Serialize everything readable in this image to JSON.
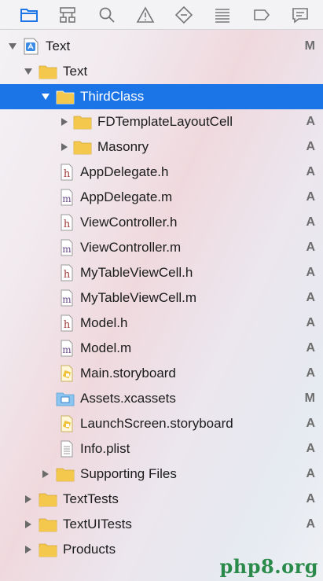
{
  "toolbar": {
    "icons": [
      "folder-icon",
      "hierarchy-icon",
      "search-icon",
      "warning-icon",
      "breakpoint-icon",
      "list-icon",
      "tag-icon",
      "comment-icon"
    ]
  },
  "colors": {
    "accent": "#1c75e6",
    "folder": "#f4c84d",
    "badge": "#6d6d6d"
  },
  "tree": [
    {
      "name": "Text",
      "type": "project",
      "disclosure": "open",
      "badge": "M"
    },
    {
      "name": "Text",
      "type": "folder",
      "disclosure": "open",
      "badge": ""
    },
    {
      "name": "ThirdClass",
      "type": "folder",
      "disclosure": "open",
      "badge": "",
      "selected": true
    },
    {
      "name": "FDTemplateLayoutCell",
      "type": "folder",
      "disclosure": "closed",
      "badge": "A"
    },
    {
      "name": "Masonry",
      "type": "folder",
      "disclosure": "closed",
      "badge": "A"
    },
    {
      "name": "AppDelegate.h",
      "type": "h",
      "disclosure": "none",
      "badge": "A"
    },
    {
      "name": "AppDelegate.m",
      "type": "m",
      "disclosure": "none",
      "badge": "A"
    },
    {
      "name": "ViewController.h",
      "type": "h",
      "disclosure": "none",
      "badge": "A"
    },
    {
      "name": "ViewController.m",
      "type": "m",
      "disclosure": "none",
      "badge": "A"
    },
    {
      "name": "MyTableViewCell.h",
      "type": "h",
      "disclosure": "none",
      "badge": "A"
    },
    {
      "name": "MyTableViewCell.m",
      "type": "m",
      "disclosure": "none",
      "badge": "A"
    },
    {
      "name": "Model.h",
      "type": "h",
      "disclosure": "none",
      "badge": "A"
    },
    {
      "name": "Model.m",
      "type": "m",
      "disclosure": "none",
      "badge": "A"
    },
    {
      "name": "Main.storyboard",
      "type": "storyboard",
      "disclosure": "none",
      "badge": "A"
    },
    {
      "name": "Assets.xcassets",
      "type": "xcassets",
      "disclosure": "none",
      "badge": "M"
    },
    {
      "name": "LaunchScreen.storyboard",
      "type": "storyboard",
      "disclosure": "none",
      "badge": "A"
    },
    {
      "name": "Info.plist",
      "type": "plist",
      "disclosure": "none",
      "badge": "A"
    },
    {
      "name": "Supporting Files",
      "type": "folder",
      "disclosure": "closed",
      "badge": "A"
    },
    {
      "name": "TextTests",
      "type": "folder",
      "disclosure": "closed",
      "badge": "A"
    },
    {
      "name": "TextUITests",
      "type": "folder",
      "disclosure": "closed",
      "badge": "A"
    },
    {
      "name": "Products",
      "type": "folder",
      "disclosure": "closed",
      "badge": ""
    }
  ],
  "watermark": "php8.org"
}
